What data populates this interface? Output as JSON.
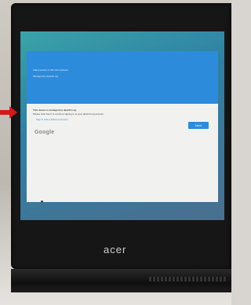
{
  "screen": {
    "header_line_1": "Add a person to this Chromebook",
    "header_line_2": "Managed by dpsk12.org",
    "body_line_1": "This device is managed by dpsk12.org.",
    "body_line_2": "Please click 'Next' to continue signing in to your dpsk12.org account.",
    "link_text": "Sign in with a different account",
    "logo_text": "Google",
    "next_label": "Next"
  },
  "device": {
    "brand": "acer"
  },
  "colors": {
    "accent_blue": "#2d8bdc",
    "arrow_red": "#d11a1a"
  }
}
